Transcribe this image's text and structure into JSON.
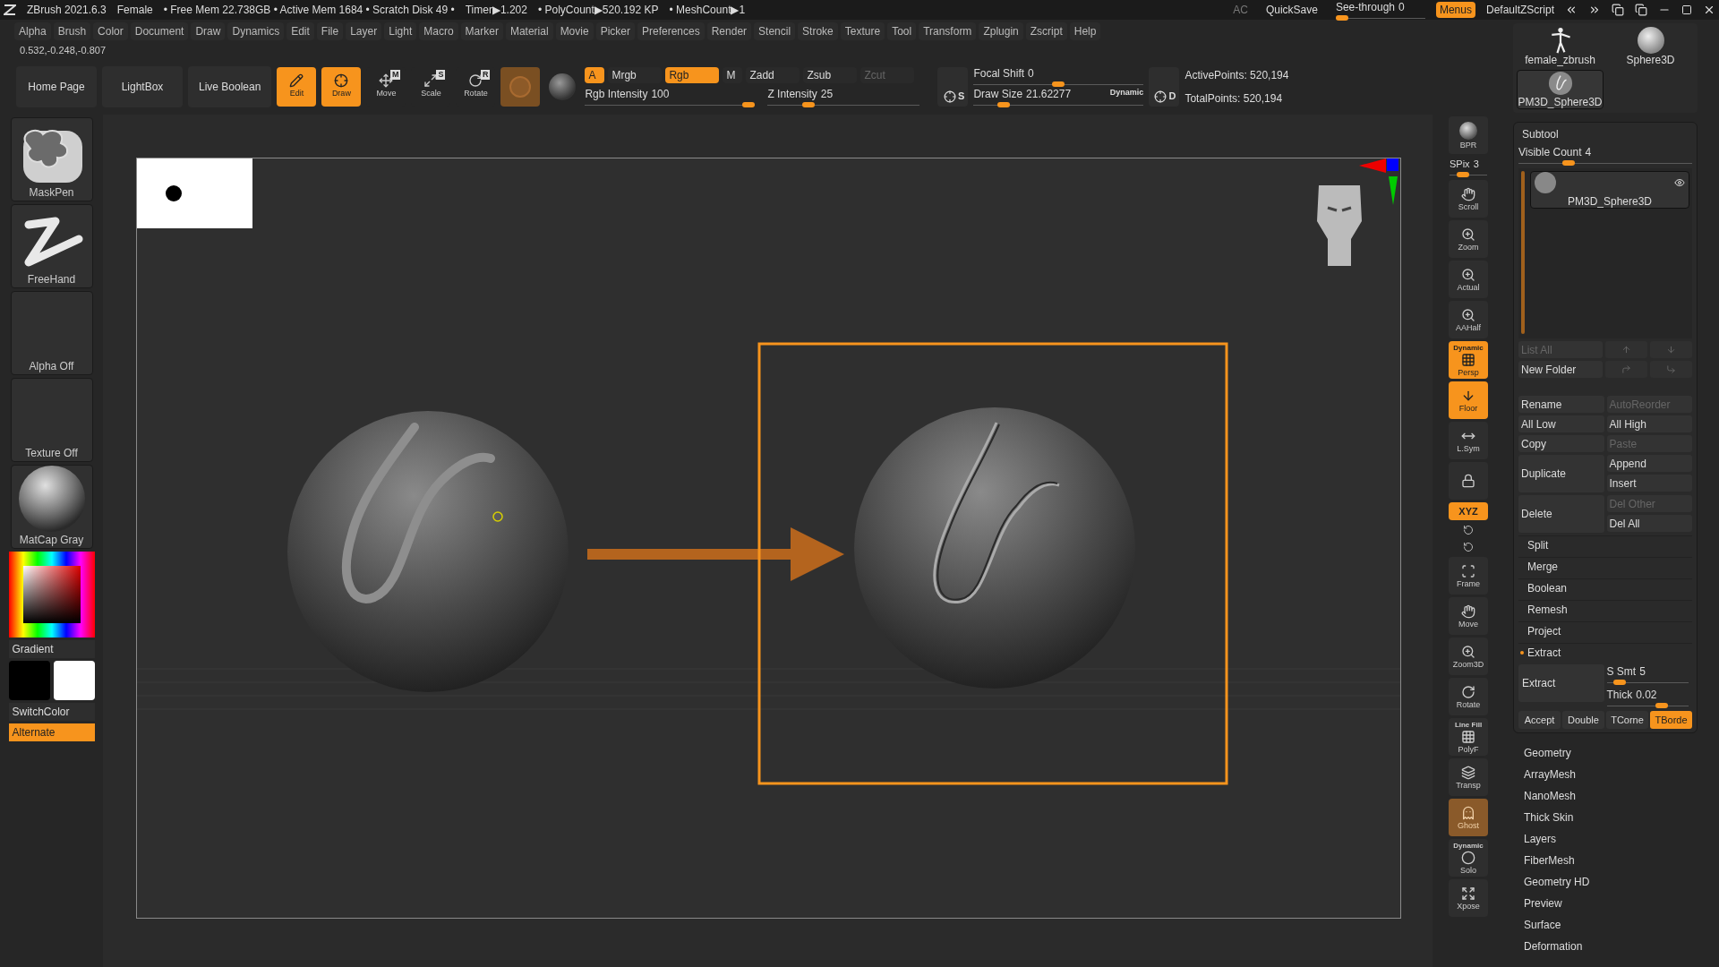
{
  "title_bar": {
    "app": "ZBrush 2021.6.3",
    "project": "Female",
    "stats": [
      "• Free Mem 22.738GB • Active Mem 1684 • Scratch Disk 49 •",
      "Timer▶1.202",
      "• PolyCount▶520.192 KP",
      "• MeshCount▶1"
    ],
    "ac": "AC",
    "quicksave": "QuickSave",
    "see_through": {
      "label": "See-through",
      "value": "0",
      "level": 0
    },
    "menus": {
      "label": "Menus",
      "on": true
    },
    "script": "DefaultZScript"
  },
  "menu_bar": [
    "Alpha",
    "Brush",
    "Color",
    "Document",
    "Draw",
    "Dynamics",
    "Edit",
    "File",
    "Layer",
    "Light",
    "Macro",
    "Marker",
    "Material",
    "Movie",
    "Picker",
    "Preferences",
    "Render",
    "Stencil",
    "Stroke",
    "Texture",
    "Tool",
    "Transform",
    "Zplugin",
    "Zscript",
    "Help"
  ],
  "coordinates": "0.532,-0.248,-0.807",
  "shelf": {
    "buttons": [
      "Home Page",
      "LightBox",
      "Live Boolean"
    ],
    "tools": [
      {
        "label": "Edit",
        "selected": true
      },
      {
        "label": "Draw",
        "selected": true
      },
      {
        "label": "Move",
        "badge": "M",
        "selected": false
      },
      {
        "label": "Scale",
        "badge": "S",
        "selected": false
      },
      {
        "label": "Rotate",
        "badge": "R",
        "selected": false
      }
    ],
    "channels": [
      {
        "label": "A",
        "on": true,
        "disabled": false
      },
      {
        "label": "Mrgb",
        "on": false,
        "disabled": false
      },
      {
        "label": "Rgb",
        "on": true,
        "disabled": false
      },
      {
        "label": "M",
        "on": false,
        "disabled": false
      },
      {
        "label": "Zadd",
        "on": false,
        "disabled": false
      },
      {
        "label": "Zsub",
        "on": false,
        "disabled": false
      },
      {
        "label": "Zcut",
        "on": false,
        "disabled": true
      }
    ],
    "rgb_intensity": {
      "label": "Rgb Intensity",
      "value": "100",
      "level": 1
    },
    "z_intensity": {
      "label": "Z Intensity",
      "value": "25",
      "level": 0.25
    },
    "focal_button": "S",
    "size_button": "D",
    "focal_shift": {
      "label": "Focal Shift",
      "value": "0",
      "level": 0.5
    },
    "draw_size": {
      "label": "Draw Size",
      "value": "21.62277",
      "level": 0.15
    },
    "dynamic": "Dynamic",
    "active_points": "ActivePoints: 520,194",
    "total_points": "TotalPoints: 520,194"
  },
  "left_shelf": {
    "tiles": [
      {
        "label": "MaskPen",
        "kind": "brush"
      },
      {
        "label": "FreeHand",
        "kind": "stroke"
      },
      {
        "label": "Alpha Off",
        "kind": "empty"
      },
      {
        "label": "Texture Off",
        "kind": "empty"
      },
      {
        "label": "MatCap Gray",
        "kind": "material"
      }
    ],
    "gradient": "Gradient",
    "swatches": [
      {
        "color": "#000000"
      },
      {
        "color": "#ffffff"
      }
    ],
    "switch_color": "SwitchColor",
    "alternate": {
      "label": "Alternate",
      "on": true
    }
  },
  "right_strip": [
    {
      "label": "BPR",
      "on": false,
      "kind": "button"
    },
    {
      "label": "SPix",
      "value": "3",
      "level": 0.3,
      "kind": "slider"
    },
    {
      "label": "Scroll",
      "on": false,
      "kind": "button"
    },
    {
      "label": "Zoom",
      "on": false,
      "kind": "button"
    },
    {
      "label": "Actual",
      "on": false,
      "kind": "button"
    },
    {
      "label": "AAHalf",
      "on": false,
      "kind": "button"
    },
    {
      "label": "Persp",
      "top": "Dynamic",
      "on": true,
      "kind": "button"
    },
    {
      "label": "Floor",
      "on": true,
      "kind": "button"
    },
    {
      "label": "L.Sym",
      "on": false,
      "kind": "button"
    },
    {
      "on": false,
      "kind": "button"
    },
    {
      "label": "XYZ",
      "on": true,
      "kind": "axis"
    },
    {
      "on": false,
      "kind": "mini"
    },
    {
      "on": false,
      "kind": "mini"
    },
    {
      "label": "Frame",
      "on": false,
      "kind": "button"
    },
    {
      "label": "Move",
      "on": false,
      "kind": "button"
    },
    {
      "label": "Zoom3D",
      "on": false,
      "kind": "button"
    },
    {
      "label": "Rotate",
      "on": false,
      "kind": "button"
    },
    {
      "label": "PolyF",
      "top": "Line Fill",
      "on": false,
      "kind": "button"
    },
    {
      "label": "Transp",
      "on": false,
      "kind": "button"
    },
    {
      "label": "Ghost",
      "on": true,
      "kind": "button"
    },
    {
      "label": "Solo",
      "top": "Dynamic",
      "on": false,
      "kind": "button"
    },
    {
      "label": "Xpose",
      "on": false,
      "kind": "button"
    }
  ],
  "tool_thumbnails": [
    {
      "label": "female_zbrush",
      "kind": "figure",
      "selected": false
    },
    {
      "label": "Sphere3D",
      "kind": "sphere",
      "selected": false
    },
    {
      "label": "PM3D_Sphere3D",
      "kind": "sculpt",
      "selected": true
    }
  ],
  "subtool": {
    "title": "Subtool",
    "visible_count": {
      "label": "Visible Count",
      "value": "4",
      "level": 0.27
    },
    "items": [
      {
        "name": "PM3D_Sphere3D",
        "selected": true
      }
    ],
    "list_rows": [
      [
        {
          "label": "List All",
          "kind": "text",
          "disabled": true
        },
        {
          "kind": "up",
          "disabled": true
        },
        {
          "kind": "down",
          "disabled": true
        }
      ],
      [
        {
          "label": "New Folder",
          "kind": "text",
          "disabled": false
        },
        {
          "kind": "move-up",
          "disabled": true
        },
        {
          "kind": "move-down",
          "disabled": true
        }
      ]
    ],
    "action_rows": [
      {
        "left": {
          "label": "Rename",
          "disabled": false
        },
        "right": [
          {
            "label": "AutoReorder",
            "disabled": true
          }
        ]
      },
      {
        "left": {
          "label": "All Low",
          "disabled": false
        },
        "right": [
          {
            "label": "All High",
            "disabled": false
          }
        ]
      },
      {
        "left": {
          "label": "Copy",
          "disabled": false
        },
        "right": [
          {
            "label": "Paste",
            "disabled": true
          }
        ]
      },
      {
        "left": {
          "label": "Duplicate",
          "disabled": false
        },
        "right": [
          {
            "label": "Append",
            "disabled": false
          },
          {
            "label": "Insert",
            "disabled": false
          }
        ]
      },
      {
        "left": {
          "label": "Delete",
          "disabled": false
        },
        "right": [
          {
            "label": "Del Other",
            "disabled": true
          },
          {
            "label": "Del All",
            "disabled": false
          }
        ]
      }
    ],
    "sections": [
      {
        "label": "Split",
        "expanded": false
      },
      {
        "label": "Merge",
        "expanded": false
      },
      {
        "label": "Boolean",
        "expanded": false
      },
      {
        "label": "Remesh",
        "expanded": false
      },
      {
        "label": "Project",
        "expanded": false
      },
      {
        "label": "Extract",
        "expanded": true
      }
    ],
    "extract": {
      "button": "Extract",
      "s_smt": {
        "label": "S Smt",
        "value": "5",
        "level": 0.1
      },
      "thick": {
        "label": "Thick",
        "value": "0.02",
        "level": 0.7
      },
      "options": [
        {
          "label": "Accept",
          "on": false
        },
        {
          "label": "Double",
          "on": false
        },
        {
          "label": "TCorne",
          "on": false
        },
        {
          "label": "TBorde",
          "on": true
        }
      ]
    }
  },
  "tool_menu": [
    "Geometry",
    "ArrayMesh",
    "NanoMesh",
    "Thick Skin",
    "Layers",
    "FiberMesh",
    "Geometry HD",
    "Preview",
    "Surface",
    "Deformation"
  ]
}
